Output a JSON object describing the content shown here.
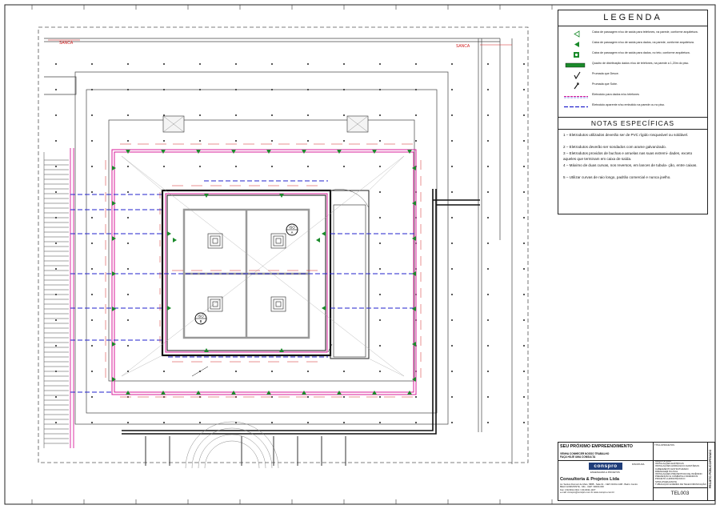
{
  "drawing": {
    "sanca_left": "SANCA",
    "sanca_right": "SANCA",
    "iso_labels": [
      {
        "line1": "ISO",
        "line2": "A"
      },
      {
        "line1": "ISO",
        "line2": "B"
      }
    ]
  },
  "legend": {
    "title": "LEGENDA",
    "items": [
      {
        "symbol": "outlet-triangle-open",
        "text": "Caixa de passagem e/ou de saída para telefones, na parede, conforme arquitetura."
      },
      {
        "symbol": "outlet-triangle-filled",
        "text": "Caixa de passagem e/ou de saída para dados, na parede, conforme arquitetura."
      },
      {
        "symbol": "outlet-floor",
        "text": "Caixa de passagem e/ou de saída para dados, no teto, conforme arquitetura."
      },
      {
        "symbol": "distribution-panel",
        "text": "Quadro de distribuição dados e/ou de telefones, na parede a 1,20m do piso."
      },
      {
        "symbol": "riser-down",
        "text": "Prumada que Desce."
      },
      {
        "symbol": "riser-up",
        "text": "Prumada que Sobe."
      },
      {
        "symbol": "conduit-ceiling",
        "text": "Eletroduto para dados e/ou telefones"
      },
      {
        "symbol": "conduit-wall",
        "text": "Eletroduto aparente e/ou embutido na parede ou no piso."
      }
    ]
  },
  "notes": {
    "title": "NOTAS ESPECÍFICAS",
    "items": [
      "1 – Eletrodutos utilizados deverão ser de PVC rígido rosqueável ou soldável.",
      "2 – Eletrodutos deverão ser sondados com arame galvanizado.",
      "3 – Eletrodutos providos de buchas e arruelas nas suas extremi- dades, exceto aqueles que terminam em caixa de saída.",
      "4 – Máximo de duas curvas, nos reversos, em lances de tubula- ção, entre caixas.",
      "5 – Utilizar curvas de raio longo, padrão comercial e nunca joelho."
    ]
  },
  "title_block": {
    "project_name": "SEU PRÓXIMO EMPREENDIMENTO",
    "project_sub_1": "VENHA CONHECER NOSSO TRABALHO",
    "project_sub_2": "FAÇA HOJE UMA CONSULTA",
    "title_label": "TÍTULO",
    "projects_label": "PROJETOS",
    "disciplines": [
      "ARQUITETURA",
      "INSTALAÇÕES ELÉTRICAS",
      "INSTALAÇÕES HIDRÁULICO-SANITÁRIAS",
      "CABEAMENTO ESTRUTURADO",
      "DRENAGEM PLUVIAL",
      "INSTALAÇÕES PREVENTIVAS DE INCÊNDIO",
      "PREVENÇÃO E COMBATE A INCÊNDIOS",
      "PROJETO LUMINOTÉCNICO",
      "SPDA (PARA-RAIOS)",
      "TUBULAÇÃO E REDES DE TELECOMUNICAÇÃO"
    ],
    "logo_text": "conspro",
    "logo_sub": "ENGENHARIA & PROJETOS",
    "discipline_label": "DISCIPLINA",
    "company": "Consultoria & Projetos Ltda",
    "address_1": "Av. Santos Dumont de Melo, 5888 - Sala 01 - CEP 21001-1108 - Bairro Centro",
    "address_2": "BELO HORIZONTE - MG - CEP: 30000-000",
    "address_3": "Fax: (31)3011-0112 / (31)3011-1107",
    "address_4": "e-mail: conspro@conspro.com.br      www.conspro.com.br",
    "drawing_code": "TEL003",
    "side_label": "PROJETO PÚBLICO/PRIVADO"
  },
  "colors": {
    "wall": "#222222",
    "conduit_magenta": "#d81b9a",
    "conduit_blue": "#2222cc",
    "outlet_green": "#1a8a2a",
    "annotation_red": "#d32020"
  }
}
